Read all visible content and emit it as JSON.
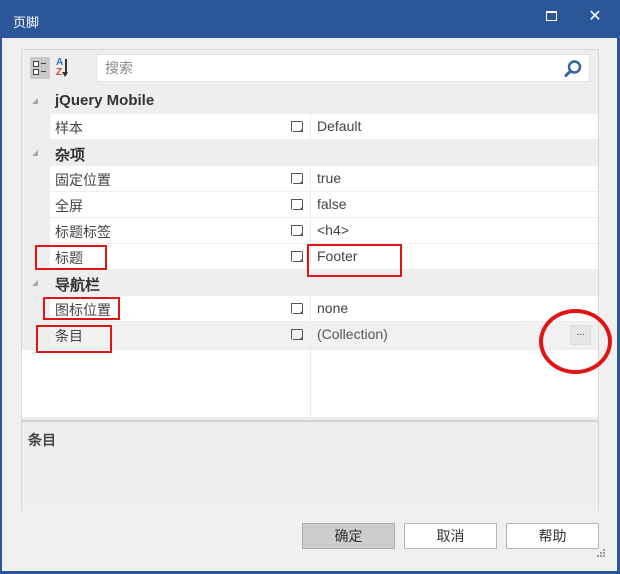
{
  "window": {
    "title": "页脚",
    "maximize_icon": "maximize-icon",
    "close_glyph": "✕"
  },
  "toolbar": {
    "categorized_icon": "categorized-view-icon",
    "alphabetical_icon": "sort-az-icon",
    "alpha_a": "A",
    "alpha_z": "Z",
    "search_placeholder": "搜索",
    "search_value": "",
    "search_icon": "search-icon"
  },
  "categories": [
    {
      "label": "jQuery Mobile",
      "properties": [
        {
          "name": "样本",
          "value": "Default"
        }
      ]
    },
    {
      "label": "杂项",
      "properties": [
        {
          "name": "固定位置",
          "value": "true"
        },
        {
          "name": "全屏",
          "value": "false"
        },
        {
          "name": "标题标签",
          "value": "<h4>"
        },
        {
          "name": "标题",
          "value": "Footer"
        }
      ]
    },
    {
      "label": "导航栏",
      "properties": [
        {
          "name": "图标位置",
          "value": "none"
        },
        {
          "name": "条目",
          "value": "(Collection)",
          "has_ellipsis": true,
          "ellipsis_label": "..."
        }
      ]
    }
  ],
  "description": {
    "title": "条目",
    "text": ""
  },
  "buttons": {
    "ok": "确定",
    "cancel": "取消",
    "help": "帮助"
  },
  "annotations": {
    "color": "#e01515",
    "highlighted": [
      "标题 name",
      "Footer value",
      "图标位置 name",
      "条目 name",
      "条目 ellipsis button"
    ]
  }
}
